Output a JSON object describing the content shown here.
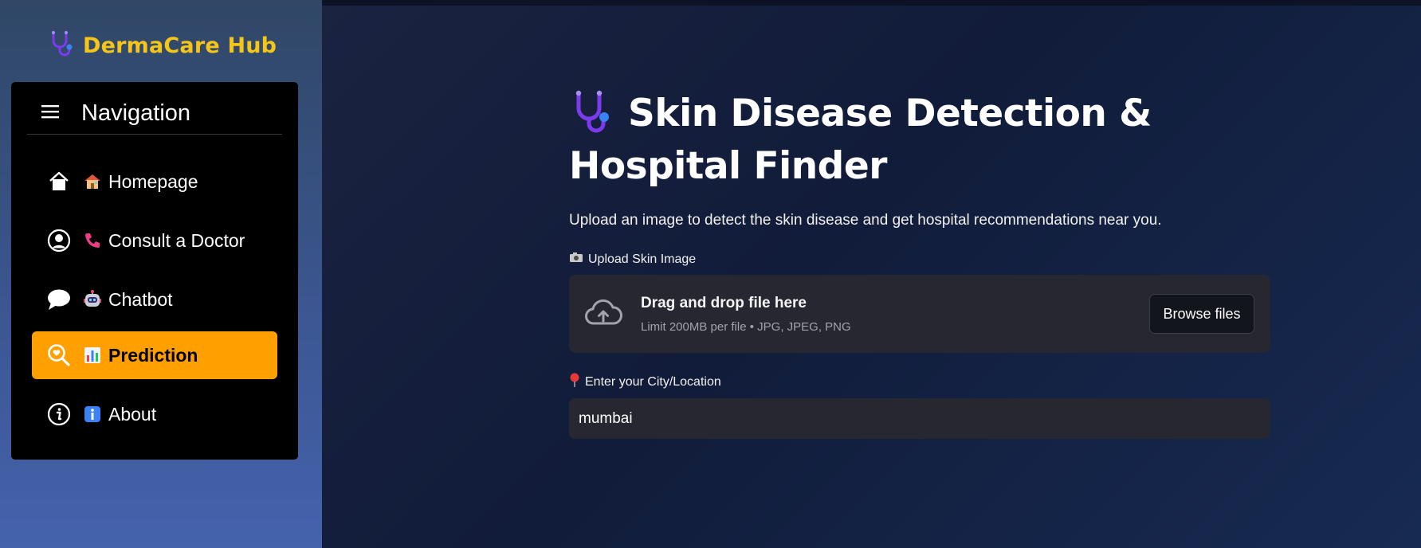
{
  "colors": {
    "brand_title": "#f5c518",
    "active_nav": "#ff9f00",
    "stethoscope": "#7c3aed",
    "stethoscope_bell": "#3b82f6"
  },
  "brand": {
    "icon": "stethoscope-icon",
    "title": "DermaCare Hub"
  },
  "nav": {
    "header_icon": "hamburger-menu-icon",
    "header_title": "Navigation",
    "items": [
      {
        "icon": "house-icon",
        "emoji": "house-emoji",
        "label": "Homepage",
        "active": false
      },
      {
        "icon": "user-circle-icon",
        "emoji": "telephone-emoji",
        "label": "Consult a Doctor",
        "active": false
      },
      {
        "icon": "chat-bubble-icon",
        "emoji": "robot-emoji",
        "label": "Chatbot",
        "active": false
      },
      {
        "icon": "search-heart-icon",
        "emoji": "bar-chart-emoji",
        "label": "Prediction",
        "active": true
      },
      {
        "icon": "info-circle-icon",
        "emoji": "info-emoji",
        "label": "About",
        "active": false
      }
    ]
  },
  "main": {
    "title_icon": "stethoscope-icon",
    "title": "Skin Disease Detection & Hospital Finder",
    "subtitle": "Upload an image to detect the skin disease and get hospital recommendations near you.",
    "upload": {
      "label_icon": "camera-icon",
      "label": "Upload Skin Image",
      "dropzone_icon": "cloud-upload-icon",
      "drop_title": "Drag and drop file here",
      "drop_limit": "Limit 200MB per file • JPG, JPEG, PNG",
      "browse_label": "Browse files"
    },
    "location": {
      "label_icon": "round-pushpin-icon",
      "label": "Enter your City/Location",
      "value": "mumbai"
    }
  }
}
